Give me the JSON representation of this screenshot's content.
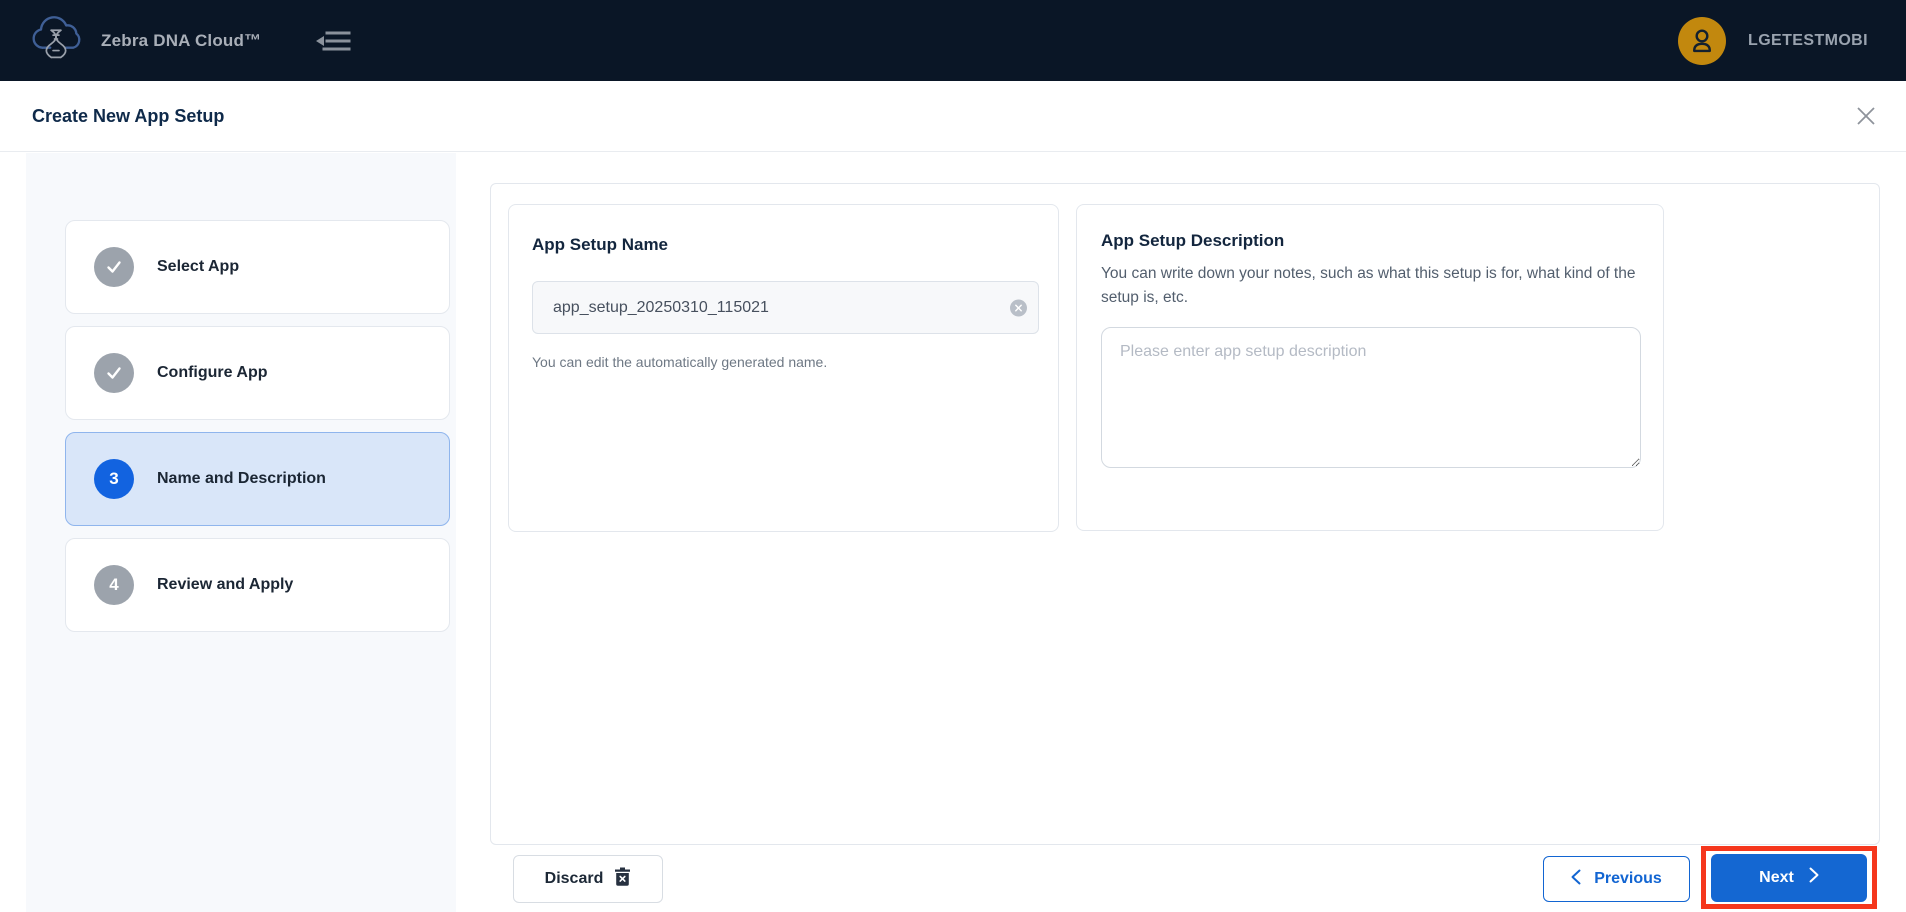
{
  "topbar": {
    "title": "Zebra DNA Cloud™",
    "username": "LGETESTMOBI"
  },
  "header": {
    "title": "Create New App Setup"
  },
  "wizard": {
    "steps": [
      {
        "label": "Select App",
        "state": "done"
      },
      {
        "label": "Configure App",
        "state": "done"
      },
      {
        "label": "Name and Description",
        "state": "active",
        "number": "3"
      },
      {
        "label": "Review and Apply",
        "state": "upcoming",
        "number": "4"
      }
    ]
  },
  "name_card": {
    "title": "App Setup Name",
    "value": "app_setup_20250310_115021",
    "helper": "You can edit the automatically generated name."
  },
  "description_card": {
    "title": "App Setup Description",
    "subtitle": "You can write down your notes, such as what this setup is for, what kind of the setup is, etc.",
    "placeholder": "Please enter app setup description"
  },
  "footer": {
    "discard_label": "Discard",
    "previous_label": "Previous",
    "next_label": "Next"
  },
  "colors": {
    "topbar_bg": "#0a1626",
    "accent_blue": "#1467d2",
    "active_step_bg": "#d9e6f9",
    "avatar_gold": "#c2880e",
    "annotation_red": "#f5371d",
    "sidebar_bg": "#f7f9fc"
  }
}
